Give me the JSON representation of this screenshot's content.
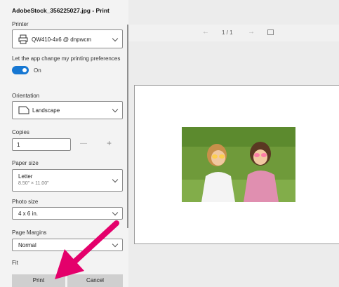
{
  "dialog": {
    "title": "AdobeStock_356225027.jpg - Print"
  },
  "printer": {
    "label": "Printer",
    "value": "QW410-4x6 @ dnpwcm"
  },
  "app_pref": {
    "label": "Let the app change my printing preferences",
    "toggle_text": "On",
    "toggle_on": true
  },
  "orientation": {
    "label": "Orientation",
    "value": "Landscape"
  },
  "copies": {
    "label": "Copies",
    "value": "1",
    "minus": "—",
    "plus": "+"
  },
  "paper_size": {
    "label": "Paper size",
    "value": "Letter",
    "sub": "8.50\" × 11.00\""
  },
  "photo_size": {
    "label": "Photo size",
    "value": "4 x 6 in."
  },
  "page_margins": {
    "label": "Page Margins",
    "value": "Normal"
  },
  "fit": {
    "label": "Fit"
  },
  "buttons": {
    "print": "Print",
    "cancel": "Cancel"
  },
  "preview": {
    "page_indicator": "1 / 1",
    "prev_icon": "arrow-left-icon",
    "next_icon": "arrow-right-icon",
    "fit_icon": "fit-page-icon"
  },
  "colors": {
    "accent": "#1677d2",
    "arrow": "#e4006b"
  }
}
